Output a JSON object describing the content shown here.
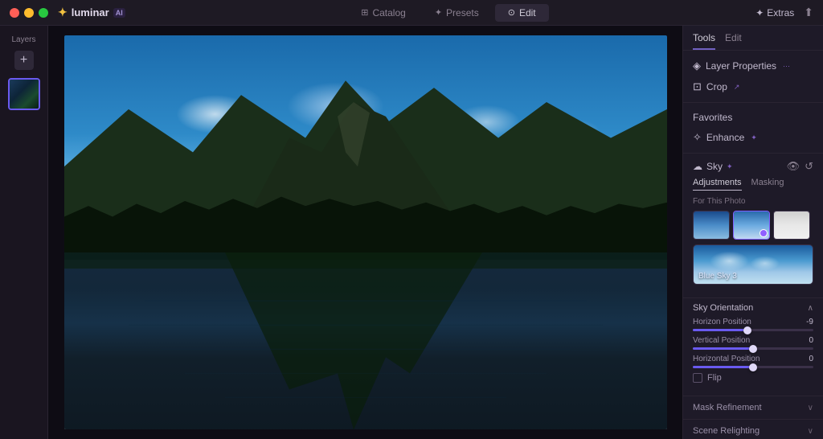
{
  "titlebar": {
    "app_name": "luminar",
    "app_badge": "AI",
    "traffic_lights": [
      "red",
      "yellow",
      "green"
    ],
    "tabs": [
      {
        "id": "catalog",
        "label": "Catalog",
        "icon": "⊞",
        "active": false
      },
      {
        "id": "presets",
        "label": "Presets",
        "icon": "✦",
        "active": false
      },
      {
        "id": "edit",
        "label": "Edit",
        "icon": "⊙",
        "active": true
      }
    ],
    "extras_label": "Extras",
    "share_icon": "↑"
  },
  "left_sidebar": {
    "layers_label": "Layers",
    "add_button_label": "+"
  },
  "right_panel": {
    "tabs": [
      {
        "id": "tools",
        "label": "Tools",
        "active": true
      },
      {
        "id": "edit",
        "label": "Edit",
        "active": false
      }
    ],
    "tools": [
      {
        "id": "layer-properties",
        "label": "Layer Properties",
        "badge": "···",
        "icon": "◈"
      },
      {
        "id": "crop",
        "label": "Crop",
        "badge": "↗",
        "icon": "⊡"
      }
    ],
    "favorites_label": "Favorites",
    "enhance": {
      "label": "Enhance",
      "badge": "✦",
      "icon": "✧"
    },
    "sky": {
      "title": "Sky",
      "badge": "✦",
      "icon": "☁",
      "visible_icon": "👁",
      "reset_icon": "↺",
      "adj_tab_label": "Adjustments",
      "mask_tab_label": "Masking",
      "for_this_photo": "For This Photo",
      "selected_sky_label": "Blue Sky 3",
      "thumbnails": [
        {
          "id": "sky-thumb-1",
          "type": "partly-cloudy"
        },
        {
          "id": "sky-thumb-2",
          "type": "blue-sky",
          "selected": true
        },
        {
          "id": "sky-thumb-3",
          "type": "overcast"
        }
      ]
    },
    "sky_orientation": {
      "title": "Sky Orientation",
      "sliders": [
        {
          "id": "horizon-position",
          "label": "Horizon Position",
          "value": -9,
          "percent": 45
        },
        {
          "id": "vertical-position",
          "label": "Vertical Position",
          "value": 0,
          "percent": 50
        },
        {
          "id": "horizontal-position",
          "label": "Horizontal Position",
          "value": 0,
          "percent": 50
        }
      ],
      "flip_label": "Flip"
    },
    "mask_refinement": {
      "title": "Mask Refinement"
    },
    "scene_relighting": {
      "title": "Scene Relighting"
    }
  }
}
